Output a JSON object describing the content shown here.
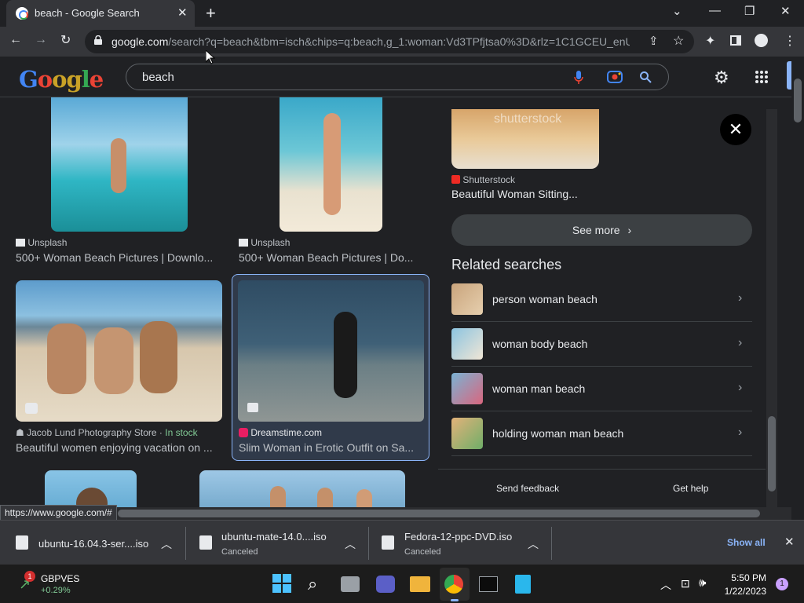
{
  "tab": {
    "title": "beach - Google Search"
  },
  "address": {
    "host": "google.com",
    "path": "/search?q=beach&tbm=isch&chips=q:beach,g_1:woman:Vd3TPfjtsa0%3D&rlz=1C1GCEU_enUS..."
  },
  "search": {
    "query": "beach"
  },
  "results": [
    {
      "source": "Unsplash",
      "caption": "500+ Woman Beach Pictures | Downlo..."
    },
    {
      "source": "Unsplash",
      "caption": "500+ Woman Beach Pictures | Do..."
    },
    {
      "source": "Jacob Lund Photography Store",
      "badge": "In stock",
      "caption": "Beautiful women enjoying vacation on ..."
    },
    {
      "source": "Dreamstime.com",
      "caption": "Slim Woman in Erotic Outfit on Sa..."
    }
  ],
  "panel": {
    "watermark": "shutterstock",
    "source": "Shutterstock",
    "caption": "Beautiful Woman Sitting...",
    "see_more": "See more",
    "related_title": "Related searches",
    "related": [
      "person woman beach",
      "woman body beach",
      "woman man beach",
      "holding woman man beach"
    ],
    "send_feedback": "Send feedback",
    "get_help": "Get help"
  },
  "status_url": "https://www.google.com/#",
  "downloads": [
    {
      "name": "ubuntu-16.04.3-ser....iso",
      "status": ""
    },
    {
      "name": "ubuntu-mate-14.0....iso",
      "status": "Canceled"
    },
    {
      "name": "Fedora-12-ppc-DVD.iso",
      "status": "Canceled"
    }
  ],
  "downloads_bar": {
    "show_all": "Show all"
  },
  "taskbar": {
    "stock_name": "GBPVES",
    "stock_change": "+0.29%",
    "widget_badge": "1",
    "time": "5:50 PM",
    "date": "1/22/2023",
    "notif_count": "1"
  },
  "colors": {
    "accent": "#8ab4f8",
    "instock": "#81c995",
    "bg": "#202124"
  }
}
